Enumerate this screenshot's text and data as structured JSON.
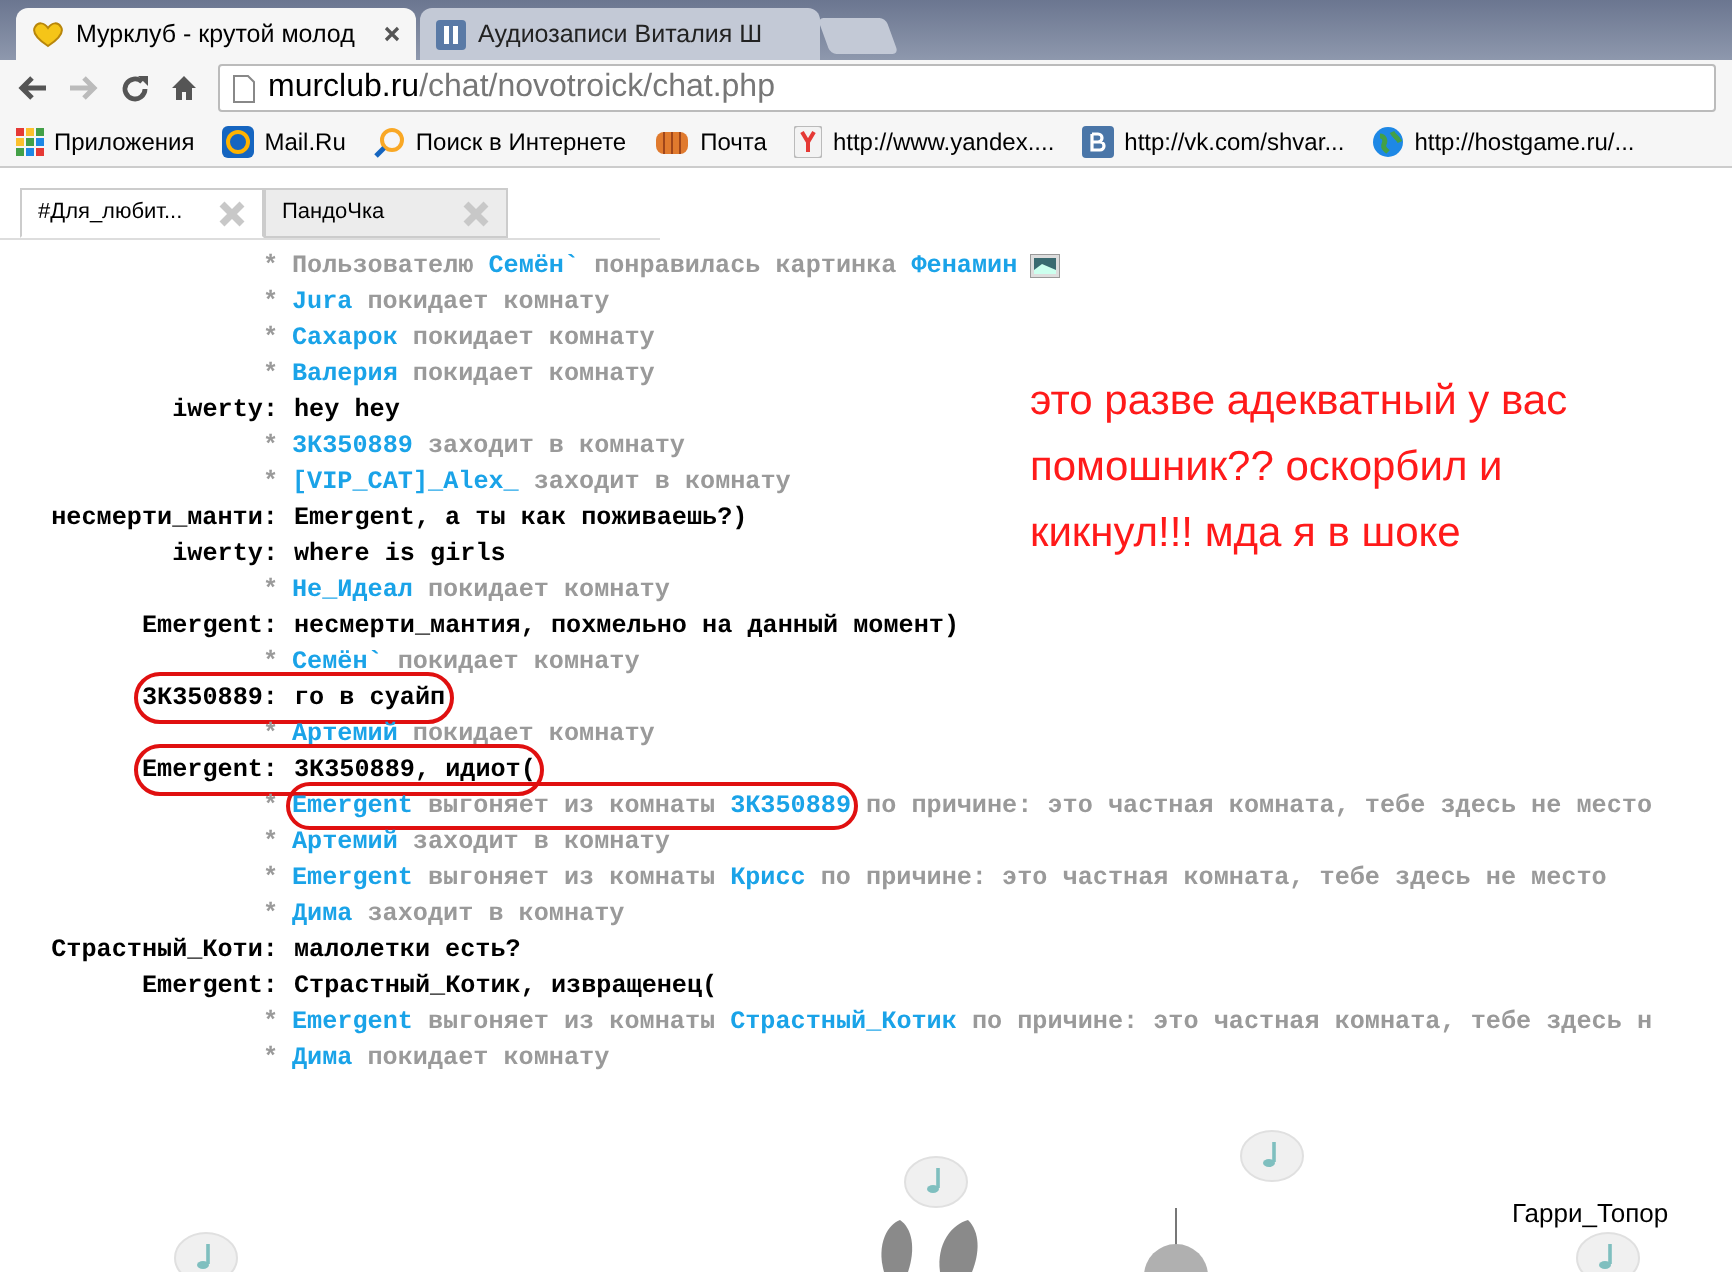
{
  "browser": {
    "tabs": [
      {
        "title": "Мурклуб - крутой молод",
        "selected": true
      },
      {
        "title": "Аудиозаписи Виталия Ш",
        "selected": false
      }
    ],
    "address": {
      "host": "murclub.ru",
      "path": "/chat/novotroick/chat.php"
    },
    "bookmarks": [
      {
        "label": "Приложения"
      },
      {
        "label": "Mail.Ru"
      },
      {
        "label": "Поиск в Интернете"
      },
      {
        "label": "Почта"
      },
      {
        "label": "http://www.yandex...."
      },
      {
        "label": "http://vk.com/shvar..."
      },
      {
        "label": "http://hostgame.ru/..."
      }
    ]
  },
  "chat_tabs": [
    {
      "label": "#Для_любит...",
      "selected": true
    },
    {
      "label": "ПандоЧка",
      "selected": false
    }
  ],
  "lines": [
    {
      "kind": "system",
      "marker": "*",
      "circled": false,
      "segments": [
        {
          "text": "Пользователю",
          "kind": "plain"
        },
        {
          "text": "Семён`",
          "kind": "name"
        },
        {
          "text": "понравилась картинка",
          "kind": "plain"
        },
        {
          "text": "Фенамин",
          "kind": "name"
        }
      ],
      "picture": true
    },
    {
      "kind": "system",
      "marker": "*",
      "circled": false,
      "segments": [
        {
          "text": "Jura",
          "kind": "name"
        },
        {
          "text": "покидает комнату",
          "kind": "plain"
        }
      ]
    },
    {
      "kind": "system",
      "marker": "*",
      "circled": false,
      "segments": [
        {
          "text": "Сахарок",
          "kind": "name"
        },
        {
          "text": "покидает комнату",
          "kind": "plain"
        }
      ]
    },
    {
      "kind": "system",
      "marker": "*",
      "circled": false,
      "segments": [
        {
          "text": "Валерия",
          "kind": "name"
        },
        {
          "text": "покидает комнату",
          "kind": "plain"
        }
      ]
    },
    {
      "kind": "message",
      "circled": false,
      "nick": "iwerty:",
      "text": "hey hey"
    },
    {
      "kind": "system",
      "marker": "*",
      "circled": false,
      "segments": [
        {
          "text": "3К350889",
          "kind": "name"
        },
        {
          "text": "заходит в комнату",
          "kind": "plain"
        }
      ]
    },
    {
      "kind": "system",
      "marker": "*",
      "circled": false,
      "segments": [
        {
          "text": "[VIP_CAT]_Alex_",
          "kind": "name"
        },
        {
          "text": "заходит в комнату",
          "kind": "plain"
        }
      ]
    },
    {
      "kind": "message",
      "circled": false,
      "nick": "несмерти_манти:",
      "text": "Emergent, а ты как поживаешь?)"
    },
    {
      "kind": "message",
      "circled": false,
      "nick": "iwerty:",
      "text": "where is girls"
    },
    {
      "kind": "system",
      "marker": "*",
      "circled": false,
      "segments": [
        {
          "text": "Не_Идеал",
          "kind": "name"
        },
        {
          "text": "покидает комнату",
          "kind": "plain"
        }
      ]
    },
    {
      "kind": "message",
      "circled": false,
      "nick": "Emergent:",
      "text": "несмерти_мантия, похмельно на данный момент)"
    },
    {
      "kind": "system",
      "marker": "*",
      "circled": false,
      "segments": [
        {
          "text": "Семён`",
          "kind": "name"
        },
        {
          "text": "покидает комнату",
          "kind": "plain"
        }
      ]
    },
    {
      "kind": "message",
      "circled": true,
      "nick": "3К350889:",
      "text": "го в суайп"
    },
    {
      "kind": "system",
      "marker": "*",
      "circled": false,
      "segments": [
        {
          "text": "Артемий",
          "kind": "name"
        },
        {
          "text": "покидает комнату",
          "kind": "plain"
        }
      ]
    },
    {
      "kind": "message",
      "circled": true,
      "nick": "Emergent:",
      "text": "3К350889, идиот("
    },
    {
      "kind": "system",
      "marker": "*",
      "circled": true,
      "segments": [
        {
          "text": "Emergent",
          "kind": "name"
        },
        {
          "text": "выгоняет из комнаты",
          "kind": "plain"
        },
        {
          "text": "3К350889",
          "kind": "name"
        }
      ],
      "after": "по причине: это частная комната, тебе здесь не место"
    },
    {
      "kind": "system",
      "marker": "*",
      "circled": false,
      "segments": [
        {
          "text": "Артемий",
          "kind": "name"
        },
        {
          "text": "заходит в комнату",
          "kind": "plain"
        }
      ]
    },
    {
      "kind": "system",
      "marker": "*",
      "circled": false,
      "segments": [
        {
          "text": "Emergent",
          "kind": "name"
        },
        {
          "text": "выгоняет из комнаты",
          "kind": "plain"
        },
        {
          "text": "Крисс",
          "kind": "name"
        },
        {
          "text": "по причине: это частная комната, тебе здесь не место",
          "kind": "plain"
        }
      ]
    },
    {
      "kind": "system",
      "marker": "*",
      "circled": false,
      "segments": [
        {
          "text": "Дима",
          "kind": "name"
        },
        {
          "text": "заходит в комнату",
          "kind": "plain"
        }
      ]
    },
    {
      "kind": "message",
      "circled": false,
      "nick": "Страстный_Коти:",
      "text": "малолетки есть?"
    },
    {
      "kind": "message",
      "circled": false,
      "nick": "Emergent:",
      "text": "Страстный_Котик, извращенец("
    },
    {
      "kind": "system",
      "marker": "*",
      "circled": false,
      "segments": [
        {
          "text": "Emergent",
          "kind": "name"
        },
        {
          "text": "выгоняет из комнаты",
          "kind": "plain"
        },
        {
          "text": "Страстный_Котик",
          "kind": "name"
        },
        {
          "text": "по причине: это частная комната, тебе здесь н",
          "kind": "plain"
        }
      ]
    },
    {
      "kind": "system",
      "marker": "*",
      "circled": false,
      "segments": [
        {
          "text": "Дима",
          "kind": "name"
        },
        {
          "text": "покидает комнату",
          "kind": "plain"
        }
      ]
    }
  ],
  "annotation": [
    "это разве адекватный у вас",
    "помошник?? оскорбил и",
    "кикнул!!! мда я в шоке"
  ],
  "stage": {
    "user_label": "Гарри_Топор"
  }
}
